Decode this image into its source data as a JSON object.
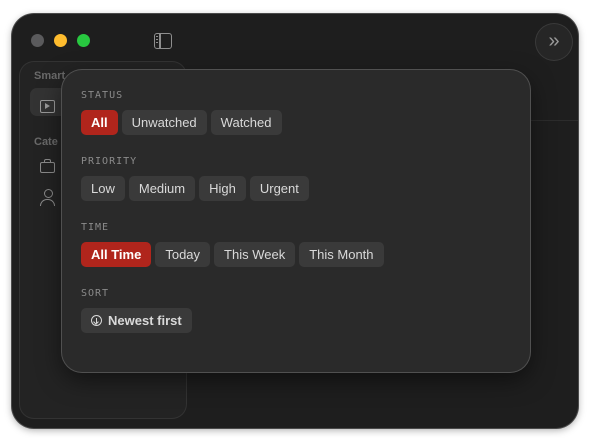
{
  "window": {
    "sidebar": {
      "headings": [
        "Smart",
        "Cate"
      ]
    }
  },
  "filters": {
    "status": {
      "label": "STATUS",
      "options": [
        "All",
        "Unwatched",
        "Watched"
      ],
      "selected": "All"
    },
    "priority": {
      "label": "PRIORITY",
      "options": [
        "Low",
        "Medium",
        "High",
        "Urgent"
      ],
      "selected": ""
    },
    "time": {
      "label": "TIME",
      "options": [
        "All Time",
        "Today",
        "This Week",
        "This Month"
      ],
      "selected": "All Time"
    },
    "sort": {
      "label": "SORT",
      "value": "Newest first",
      "icon": "arrow-down-circle-icon"
    }
  },
  "colors": {
    "accent": "#b0251c",
    "chip": "#3a3a3a",
    "popover": "#2a2a2a",
    "window": "#1e1e1e"
  }
}
